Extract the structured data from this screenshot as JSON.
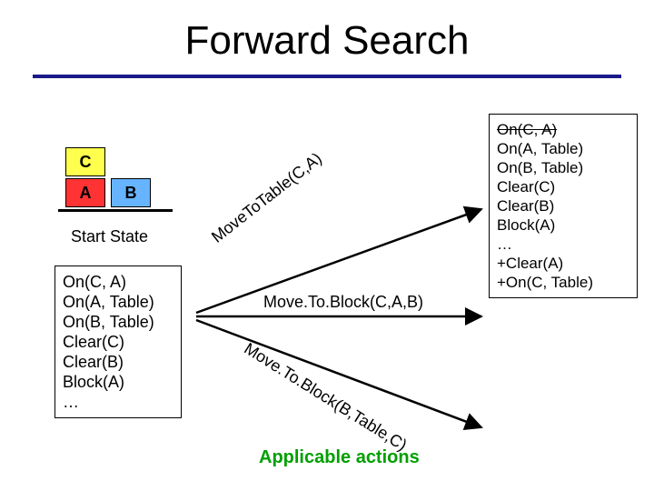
{
  "title": "Forward Search",
  "blocks": {
    "C": "C",
    "A": "A",
    "B": "B"
  },
  "start_label": "Start State",
  "state_preds": {
    "l1": "On(C, A)",
    "l2": "On(A, Table)",
    "l3": "On(B, Table)",
    "l4": "Clear(C)",
    "l5": "Clear(B)",
    "l6": "Block(A)",
    "l7": "…"
  },
  "actions": {
    "up": "MoveToTable(C,A)",
    "mid": "Move.To.Block(C,A,B)",
    "down": "Move.To.Block(B,Table,C)"
  },
  "result_preds": {
    "r1": "On(C, A)",
    "r2": "On(A, Table)",
    "r3": "On(B, Table)",
    "r4": "Clear(C)",
    "r5": "Clear(B)",
    "r6": "Block(A)",
    "r7": "…",
    "r8": "+Clear(A)",
    "r9": "+On(C, Table)"
  },
  "applicable_label": "Applicable actions"
}
